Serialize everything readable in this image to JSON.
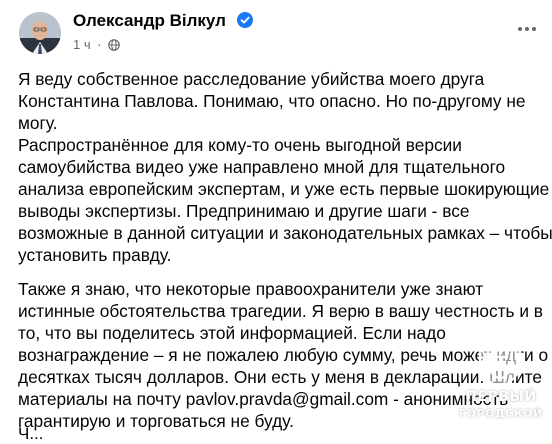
{
  "post": {
    "author": "Олександр Вілкул",
    "time": "1 ч",
    "separator": "·",
    "icons": {
      "verified": "verified-badge-icon",
      "audience": "globe-icon",
      "more": "more-options-icon"
    },
    "paragraph1": [
      "Я веду собственное расследование убийства моего друга",
      "Константина Павлова. Понимаю, что опасно. Но по-другому не",
      "могу.",
      "Распространённое для кому-то очень выгодной версии",
      "самоубийства видео уже направлено мной для тщательного",
      "анализа европейским экспертам, и уже есть первые шокирующие",
      "выводы экспертизы. Предпринимаю и другие шаги - все",
      "возможные в данной ситуации и законодательных рамках – чтобы",
      "установить правду."
    ],
    "paragraph2": [
      "Также я знаю, что некоторые правоохранители уже знают",
      "истинные обстоятельства трагедии. Я верю в вашу честность и в",
      "то, что вы поделитесь этой информацией. Если надо",
      "вознаграждение – я не пожалею любую сумму, речь может идти о",
      "десятках тысяч долларов. Они есть у меня в декларации. Шлите",
      "материалы на почту pavlov.pravda@gmail.com - анонимность",
      "гарантирую и торговаться не буду."
    ],
    "cut_off": "Ч..."
  },
  "watermark": {
    "line1": "ПЕРВЫЙ",
    "line2": "ГОРОДСКОЙ"
  },
  "colors": {
    "text": "#050505",
    "secondary": "#65676b",
    "verified": "#1877f2"
  }
}
